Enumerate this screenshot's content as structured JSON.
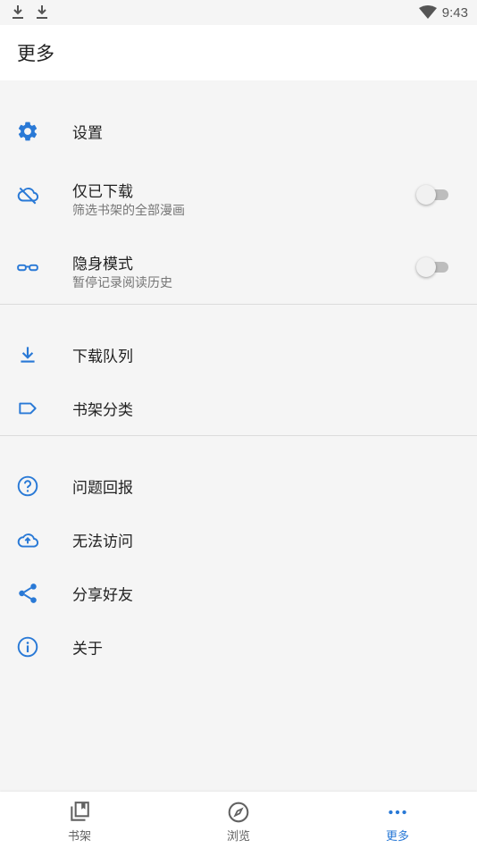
{
  "status_bar": {
    "time": "9:43",
    "icons": [
      "download-icon",
      "download-icon",
      "wifi-icon"
    ]
  },
  "app_bar": {
    "title": "更多"
  },
  "menu": {
    "settings": {
      "label": "设置",
      "icon": "gear-icon"
    },
    "downloaded_only": {
      "label": "仅已下载",
      "sublabel": "筛选书架的全部漫画",
      "icon": "cloud-off-icon",
      "toggle_on": false
    },
    "incognito": {
      "label": "隐身模式",
      "sublabel": "暂停记录阅读历史",
      "icon": "glasses-icon",
      "toggle_on": false
    },
    "download_queue": {
      "label": "下载队列",
      "icon": "download-icon"
    },
    "categories": {
      "label": "书架分类",
      "icon": "label-icon"
    },
    "feedback": {
      "label": "问题回报",
      "icon": "help-icon"
    },
    "cannot_access": {
      "label": "无法访问",
      "icon": "cloud-upload-icon"
    },
    "share": {
      "label": "分享好友",
      "icon": "share-icon"
    },
    "about": {
      "label": "关于",
      "icon": "info-icon"
    }
  },
  "bottom_nav": {
    "items": [
      {
        "label": "书架",
        "icon": "library-icon",
        "active": false
      },
      {
        "label": "浏览",
        "icon": "compass-icon",
        "active": false
      },
      {
        "label": "更多",
        "icon": "more-horiz-icon",
        "active": true
      }
    ]
  },
  "colors": {
    "accent": "#2979d6",
    "background": "#f5f5f5",
    "surface": "#ffffff",
    "text_primary": "#212121",
    "text_secondary": "#757575"
  }
}
